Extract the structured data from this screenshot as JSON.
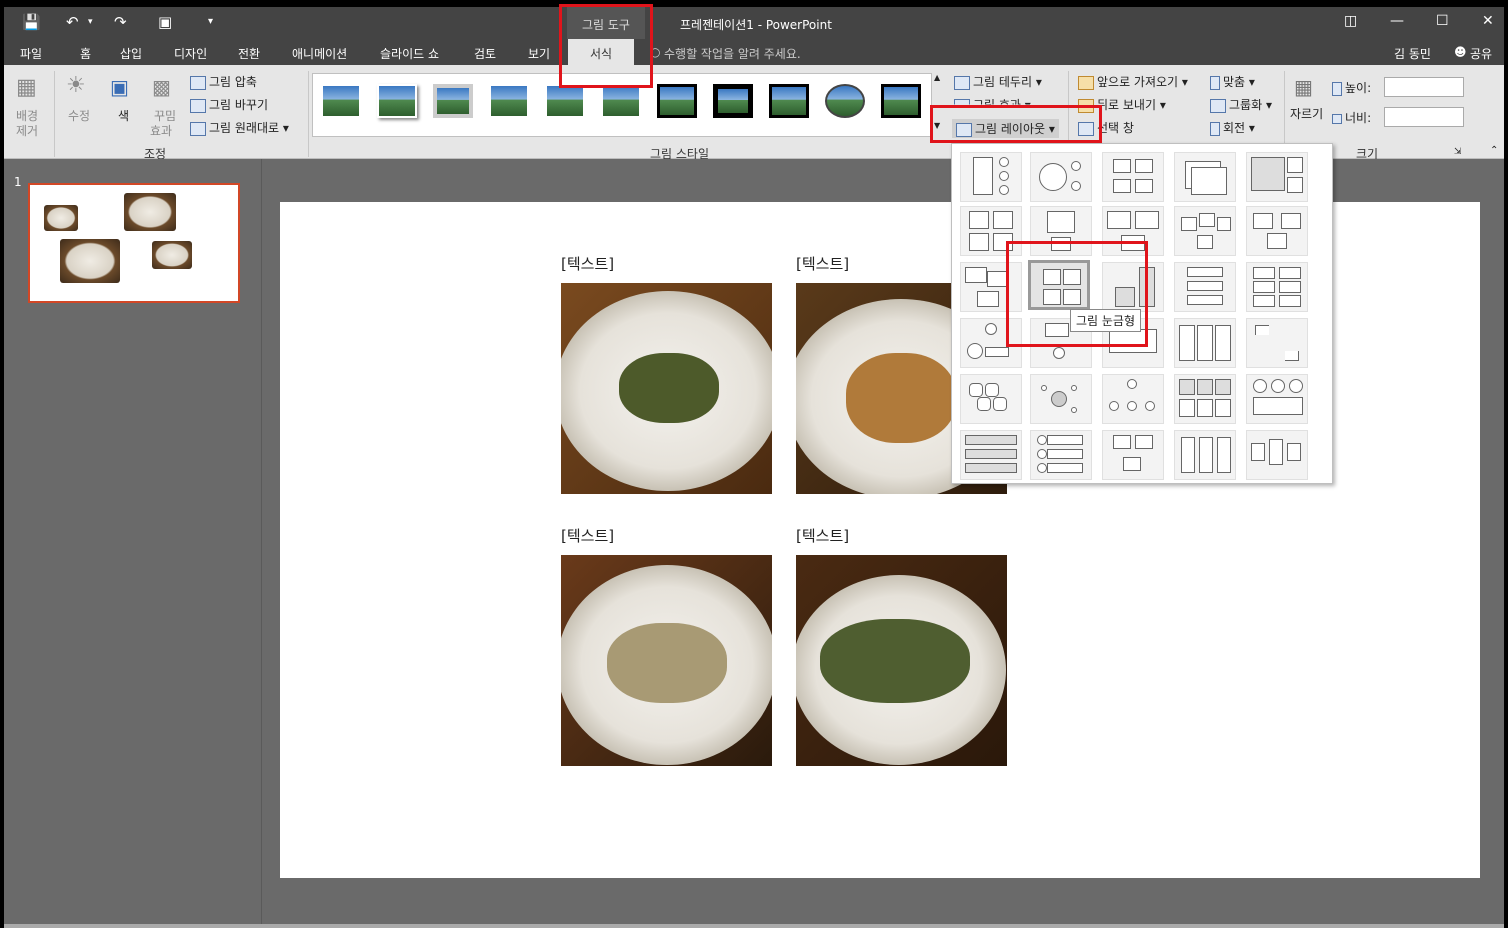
{
  "titlebar": {
    "title": "프레젠테이션1 - PowerPoint",
    "context_group": "그림 도구",
    "user": "김 동민",
    "share": "공유"
  },
  "tabs": [
    {
      "label": "파일"
    },
    {
      "label": "홈"
    },
    {
      "label": "삽입"
    },
    {
      "label": "디자인"
    },
    {
      "label": "전환"
    },
    {
      "label": "애니메이션"
    },
    {
      "label": "슬라이드 쇼"
    },
    {
      "label": "검토"
    },
    {
      "label": "보기"
    },
    {
      "label": "서식"
    }
  ],
  "tell_me": "수행할 작업을 알려 주세요.",
  "ribbon": {
    "adjust": {
      "remove_bg": "배경",
      "remove_bg2": "제거",
      "correct": "수정",
      "color": "색",
      "artistic": "꾸밈",
      "artistic2": "효과",
      "compress": "그림 압축",
      "change": "그림 바꾸기",
      "reset": "그림 원래대로",
      "group_label": "조정"
    },
    "styles": {
      "group_label": "그림 스타일",
      "border": "그림 테두리",
      "effects": "그림 효과",
      "layout": "그림 레이아웃"
    },
    "arrange": {
      "bring_forward": "앞으로 가져오기",
      "send_backward": "뒤로 보내기",
      "selection_pane": "선택 창",
      "align": "맞춤",
      "group": "그룹화",
      "rotate": "회전"
    },
    "size": {
      "crop": "자르기",
      "height": "높이:",
      "width": "너비:",
      "group_label": "크기"
    }
  },
  "thumbnails": {
    "slide_number": "1"
  },
  "slide": {
    "placeholders": [
      "[텍스트]",
      "[텍스트]",
      "[텍스트]",
      "[텍스트]"
    ]
  },
  "layout_gallery": {
    "tooltip": "그림 눈금형",
    "selected": "그림 눈금형"
  }
}
